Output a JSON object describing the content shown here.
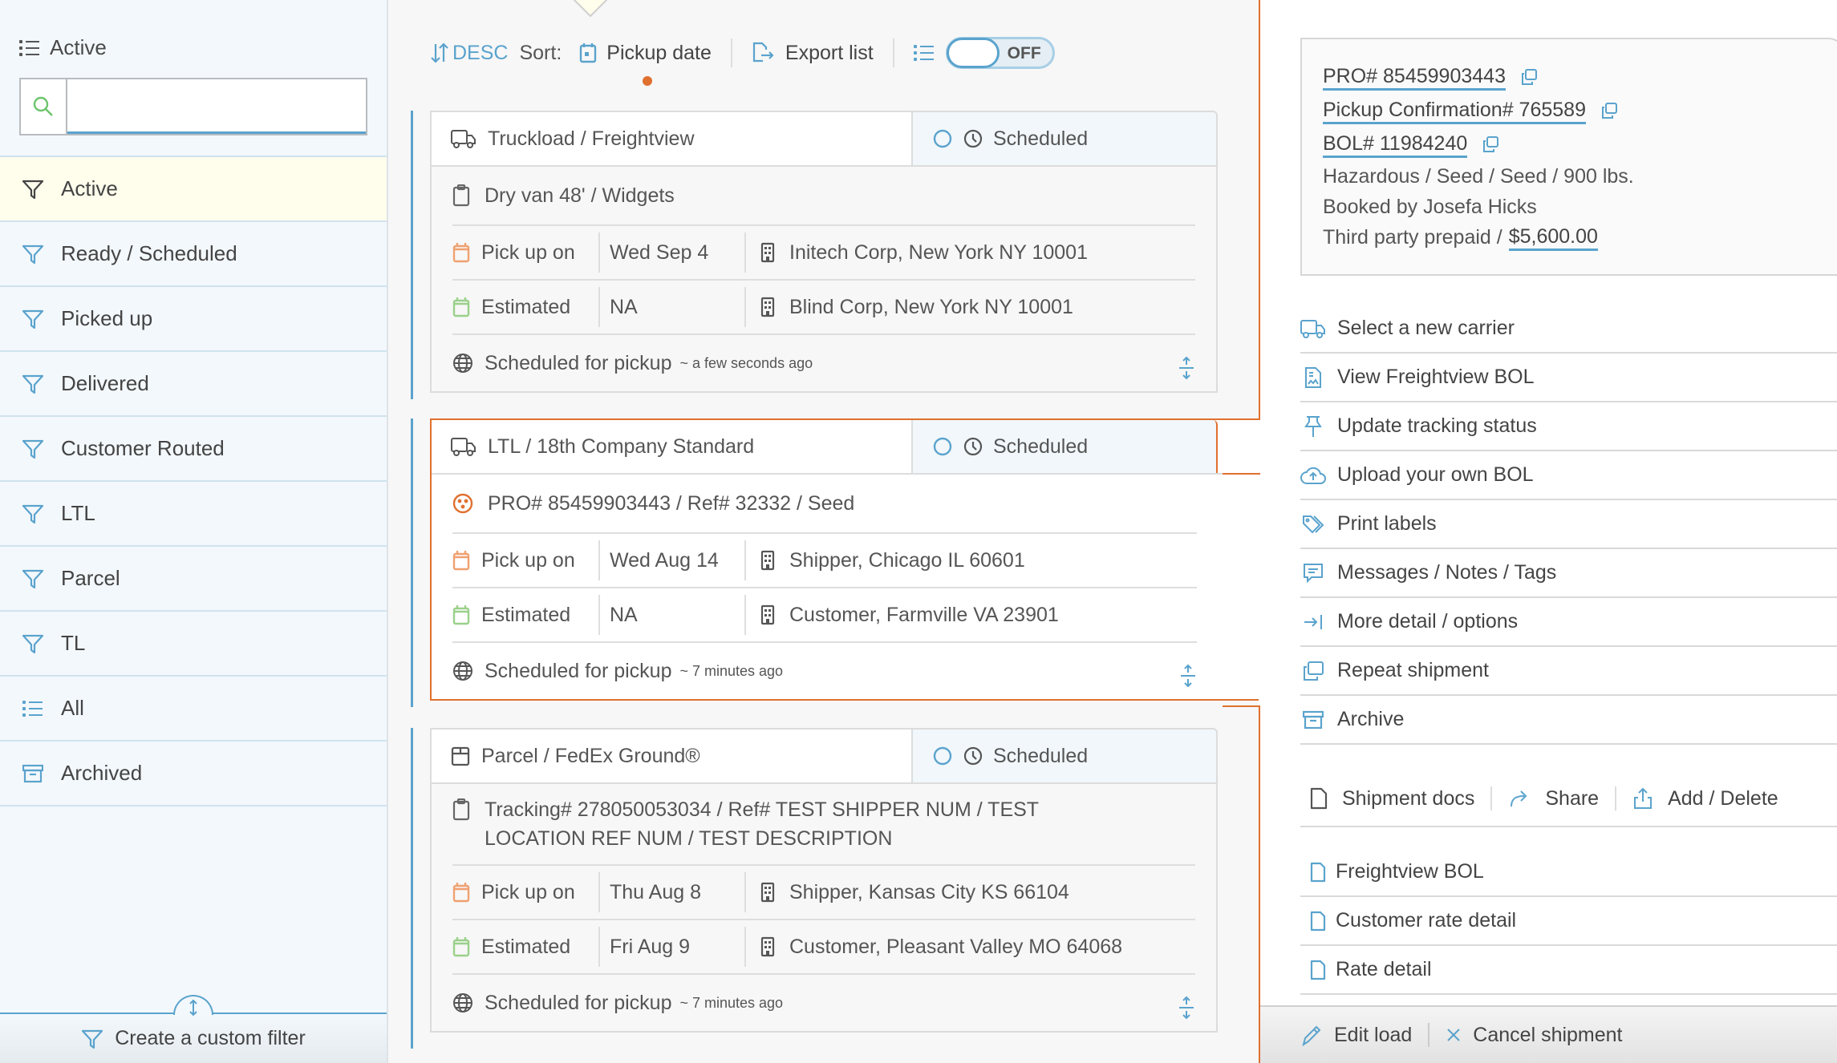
{
  "colors": {
    "accent": "#5aa3cd",
    "selected_border": "#e0702f",
    "active_filter_bg": "#fffdec",
    "pickup_icon": "#f0a070",
    "estimated_icon": "#9ad08a",
    "hazard_icon": "#e0702f",
    "search_icon": "#6cc46c"
  },
  "sidebar": {
    "header": {
      "icon": "list-icon",
      "label": "Active"
    },
    "search": {
      "icon": "search-icon",
      "value": "",
      "placeholder": ""
    },
    "items": [
      {
        "icon": "filter-icon",
        "label": "Active",
        "active": true
      },
      {
        "icon": "filter-icon",
        "label": "Ready / Scheduled"
      },
      {
        "icon": "filter-icon",
        "label": "Picked up"
      },
      {
        "icon": "filter-icon",
        "label": "Delivered"
      },
      {
        "icon": "filter-icon",
        "label": "Customer Routed"
      },
      {
        "icon": "filter-icon",
        "label": "LTL"
      },
      {
        "icon": "filter-icon",
        "label": "Parcel"
      },
      {
        "icon": "filter-icon",
        "label": "TL"
      },
      {
        "icon": "list-icon",
        "label": "All"
      },
      {
        "icon": "archive-icon",
        "label": "Archived"
      }
    ],
    "footer": {
      "icon": "filter-icon",
      "label": "Create a custom filter"
    }
  },
  "toolbar": {
    "order_label": "DESC",
    "sort_label": "Sort:",
    "sort_field": "Pickup date",
    "export_label": "Export list",
    "toggle_label": "OFF",
    "toggle_on": false
  },
  "shipments": [
    {
      "carrier": "Truckload / Freightview",
      "carrier_icon": "truck-icon",
      "status": "Scheduled",
      "description": "Dry van 48' / Widgets",
      "description_icon": "clipboard-icon",
      "pickup_label": "Pick up on",
      "pickup_date": "Wed Sep 4",
      "origin": "Initech Corp, New York NY 10001",
      "estimated_label": "Estimated",
      "estimated_date": "NA",
      "destination": "Blind Corp, New York NY 10001",
      "event": "Scheduled for pickup",
      "event_time": "~ a few seconds ago",
      "selected": false
    },
    {
      "carrier": "LTL / 18th Company Standard",
      "carrier_icon": "truck-icon",
      "status": "Scheduled",
      "description": "PRO# 85459903443 / Ref# 32332 / Seed",
      "description_icon": "hazard-icon",
      "pickup_label": "Pick up on",
      "pickup_date": "Wed Aug 14",
      "origin": "Shipper, Chicago IL 60601",
      "estimated_label": "Estimated",
      "estimated_date": "NA",
      "destination": "Customer, Farmville VA 23901",
      "event": "Scheduled for pickup",
      "event_time": "~ 7 minutes ago",
      "selected": true
    },
    {
      "carrier": "Parcel / FedEx Ground®",
      "carrier_icon": "package-icon",
      "status": "Scheduled",
      "description": "Tracking# 278050053034 / Ref# TEST SHIPPER NUM / TEST LOCATION REF NUM / TEST DESCRIPTION",
      "description_icon": "clipboard-icon",
      "pickup_label": "Pick up on",
      "pickup_date": "Thu Aug 8",
      "origin": "Shipper, Kansas City KS 66104",
      "estimated_label": "Estimated",
      "estimated_date": "Fri Aug 9",
      "destination": "Customer, Pleasant Valley MO 64068",
      "event": "Scheduled for pickup",
      "event_time": "~ 7 minutes ago",
      "selected": false
    }
  ],
  "detail": {
    "pro": "PRO# 85459903443",
    "pickup_confirmation": "Pickup Confirmation# 765589",
    "bol": "BOL# 11984240",
    "summary": "Hazardous / Seed / Seed / 900 lbs.",
    "booked_by": "Booked by Josefa Hicks",
    "payment_terms": "Third party prepaid /",
    "amount": "$5,600.00",
    "actions": [
      {
        "icon": "truck-icon",
        "label": "Select a new carrier"
      },
      {
        "icon": "document-icon",
        "label": "View Freightview BOL"
      },
      {
        "icon": "pin-icon",
        "label": "Update tracking status"
      },
      {
        "icon": "cloud-upload-icon",
        "label": "Upload your own BOL"
      },
      {
        "icon": "tag-icon",
        "label": "Print labels"
      },
      {
        "icon": "message-icon",
        "label": "Messages / Notes / Tags"
      },
      {
        "icon": "arrow-right-bar-icon",
        "label": "More detail / options"
      },
      {
        "icon": "copy-icon",
        "label": "Repeat shipment"
      },
      {
        "icon": "archive-icon",
        "label": "Archive"
      }
    ],
    "docs_header": {
      "label": "Shipment docs",
      "share": "Share",
      "add_delete": "Add / Delete"
    },
    "docs": [
      "Freightview BOL",
      "Customer rate detail",
      "Rate detail"
    ],
    "footer": {
      "edit": "Edit load",
      "cancel": "Cancel shipment"
    }
  }
}
